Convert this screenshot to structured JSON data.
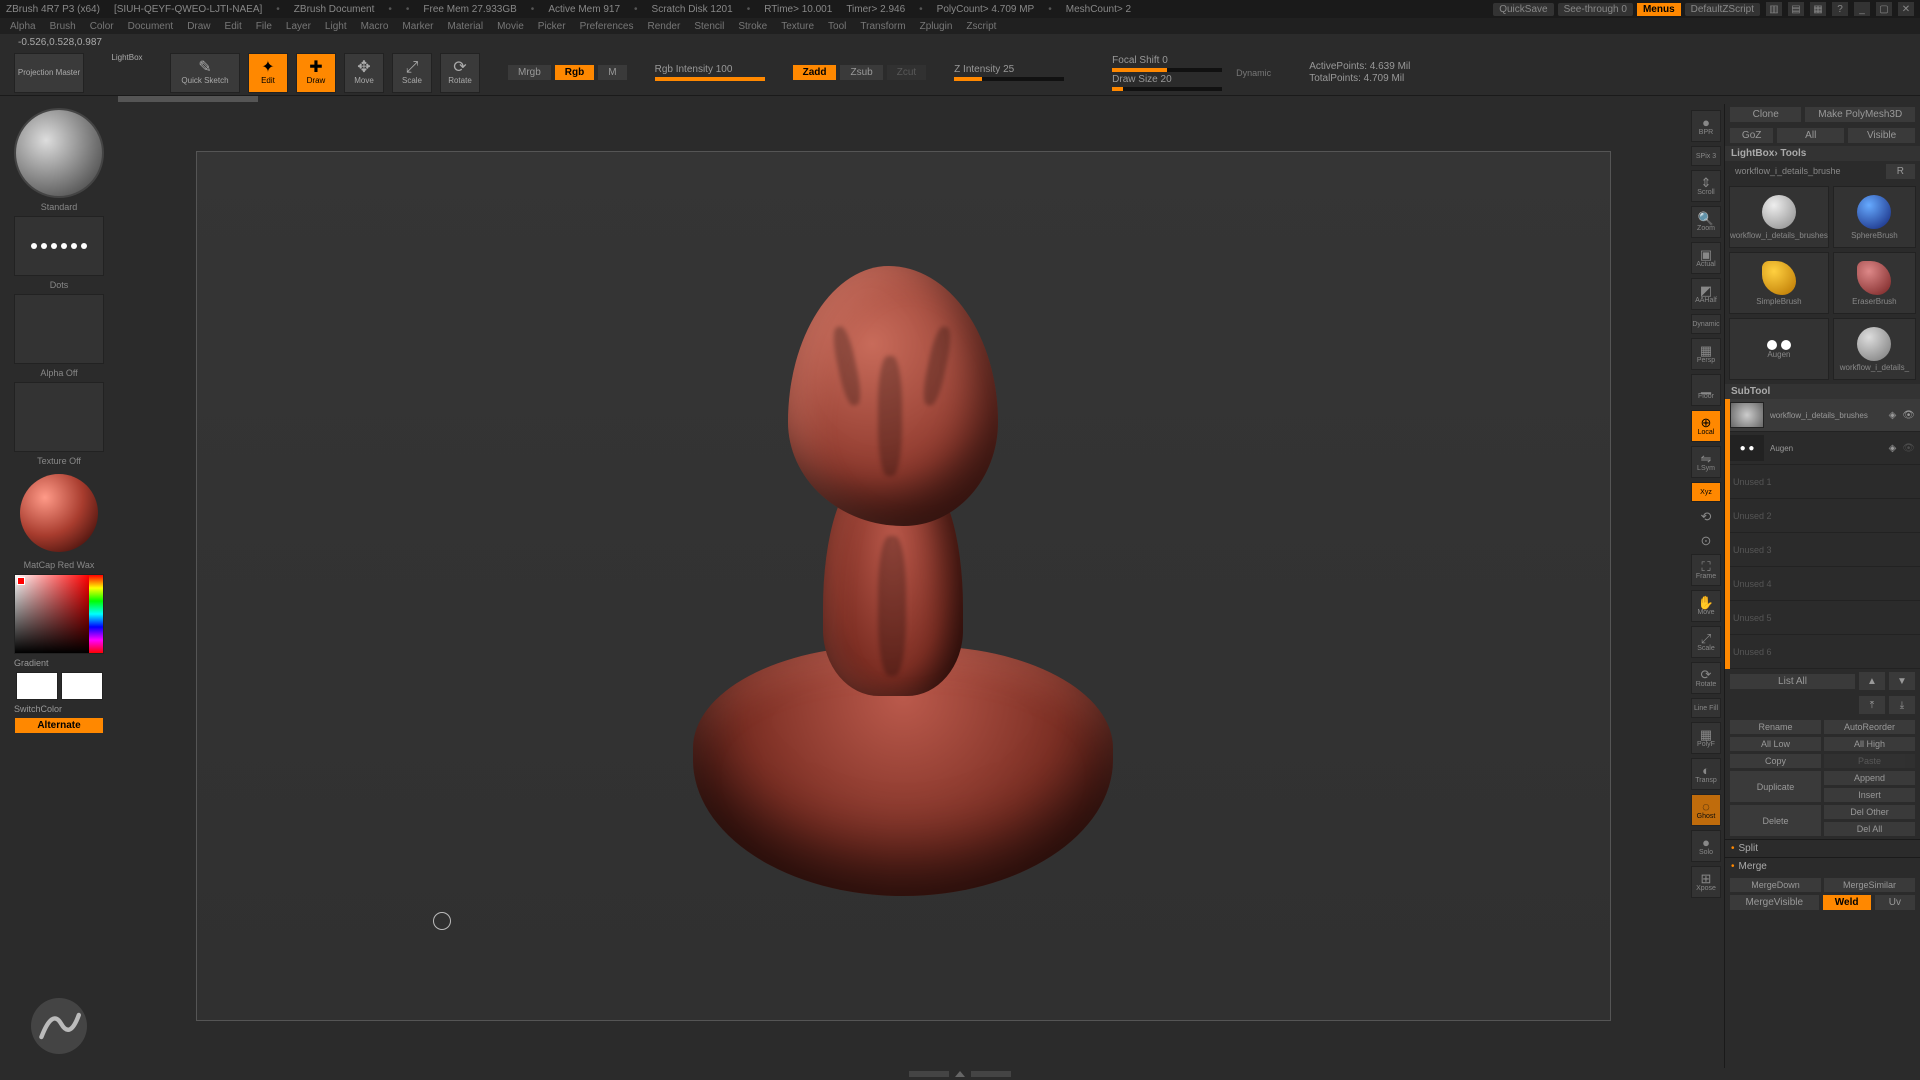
{
  "titlebar": {
    "app": "ZBrush 4R7 P3 (x64)",
    "file": "[SIUH-QEYF-QWEO-LJTI-NAEA]",
    "doc": "ZBrush Document",
    "freemem": "Free Mem 27.933GB",
    "activemem": "Active Mem 917",
    "scratch": "Scratch Disk 1201",
    "rtime": "RTime> 10.001",
    "timer": "Timer> 2.946",
    "polycount": "PolyCount> 4.709 MP",
    "meshcount": "MeshCount> 2",
    "quicksave": "QuickSave",
    "seethrough": "See-through   0",
    "menus": "Menus",
    "script": "DefaultZScript"
  },
  "menus": [
    "Alpha",
    "Brush",
    "Color",
    "Document",
    "Draw",
    "Edit",
    "File",
    "Layer",
    "Light",
    "Macro",
    "Marker",
    "Material",
    "Movie",
    "Picker",
    "Preferences",
    "Render",
    "Stencil",
    "Stroke",
    "Texture",
    "Tool",
    "Transform",
    "Zplugin",
    "Zscript"
  ],
  "status": "-0.526,0.528,0.987",
  "toolbar": {
    "projection": "Projection Master",
    "lightbox": "LightBox",
    "quicksketch": "Quick Sketch",
    "edit": "Edit",
    "draw": "Draw",
    "move": "Move",
    "scale": "Scale",
    "rotate": "Rotate",
    "mrgb": "Mrgb",
    "rgb": "Rgb",
    "m": "M",
    "rgbint": "Rgb Intensity 100",
    "zadd": "Zadd",
    "zsub": "Zsub",
    "zcut": "Zcut",
    "zint": "Z Intensity 25",
    "focal": "Focal Shift 0",
    "drawsize": "Draw Size 20",
    "dynamic": "Dynamic",
    "active": "ActivePoints: 4.639 Mil",
    "total": "TotalPoints: 4.709 Mil"
  },
  "left": {
    "brush": "Standard",
    "stroke": "Dots",
    "alpha": "Alpha  Off",
    "texture": "Texture Off",
    "material": "MatCap Red Wax",
    "gradient": "Gradient",
    "switch": "SwitchColor",
    "alternate": "Alternate"
  },
  "nav": {
    "bpr": "BPR",
    "spix": "SPix 3",
    "scroll": "Scroll",
    "zoom": "Zoom",
    "actual": "Actual",
    "aahalf": "AAHalf",
    "dynamic": "Dynamic",
    "persp": "Persp",
    "floor": "Floor",
    "local": "Local",
    "lsym": "LSym",
    "xyz": "Xyz",
    "frame": "Frame",
    "moveN": "Move",
    "scaleN": "Scale",
    "rotateN": "Rotate",
    "linefill": "Line Fill",
    "polyf": "PolyF",
    "transp": "Transp",
    "ghost": "Ghost",
    "solo": "Solo",
    "xpose": "Xpose"
  },
  "right": {
    "clone": "Clone",
    "makep": "Make PolyMesh3D",
    "goz": "GoZ",
    "all": "All",
    "visible": "Visible",
    "lbtools": "LightBox› Tools",
    "path": "workflow_i_details_brushe",
    "r": "R",
    "tools": [
      {
        "name": "workflow_i_details_brushes"
      },
      {
        "name": "SphereBrush"
      },
      {
        "name": "SimpleBrush"
      },
      {
        "name": "EraserBrush"
      },
      {
        "name": "Augen"
      },
      {
        "name": "workflow_i_details_"
      }
    ],
    "subtool_hdr": "SubTool",
    "subtools": [
      {
        "name": "workflow_i_details_brushes"
      },
      {
        "name": "Augen"
      }
    ],
    "slots": [
      "Unused 1",
      "Unused 2",
      "Unused 3",
      "Unused 4",
      "Unused 5",
      "Unused 6"
    ],
    "listall": "List All",
    "rename": "Rename",
    "autoreorder": "AutoReorder",
    "alllow": "All Low",
    "allhigh": "All High",
    "copy": "Copy",
    "paste": "Paste",
    "duplicate": "Duplicate",
    "append": "Append",
    "insert": "Insert",
    "delete": "Delete",
    "delother": "Del Other",
    "delall": "Del All",
    "split": "Split",
    "merge": "Merge",
    "mergedown": "MergeDown",
    "mergesimilar": "MergeSimilar",
    "mergevisible": "MergeVisible",
    "weld": "Weld",
    "uv": "Uv"
  }
}
